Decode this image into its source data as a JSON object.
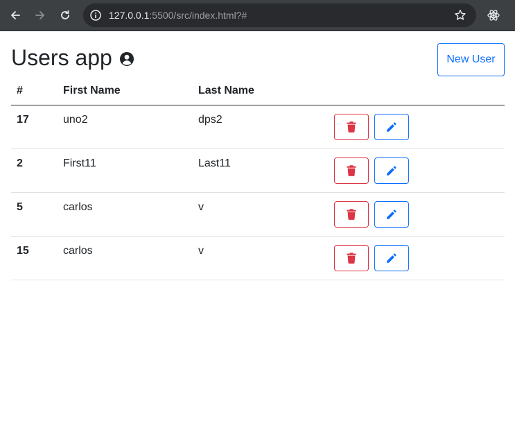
{
  "browser": {
    "url_host": "127.0.0.1",
    "url_rest": ":5500/src/index.html?#"
  },
  "header": {
    "title": "Users app",
    "new_user_label": "New User"
  },
  "table": {
    "columns": [
      "#",
      "First Name",
      "Last Name",
      ""
    ],
    "rows": [
      {
        "id": "17",
        "first": "uno2",
        "last": "dps2"
      },
      {
        "id": "2",
        "first": "First11",
        "last": "Last11"
      },
      {
        "id": "5",
        "first": "carlos",
        "last": "v"
      },
      {
        "id": "15",
        "first": "carlos",
        "last": "v"
      }
    ]
  },
  "colors": {
    "primary": "#0d6efd",
    "danger": "#dc3545",
    "chrome": "#3c4043"
  },
  "icons": {
    "title": "user-circle-icon",
    "delete": "trash-icon",
    "edit": "pencil-icon"
  }
}
